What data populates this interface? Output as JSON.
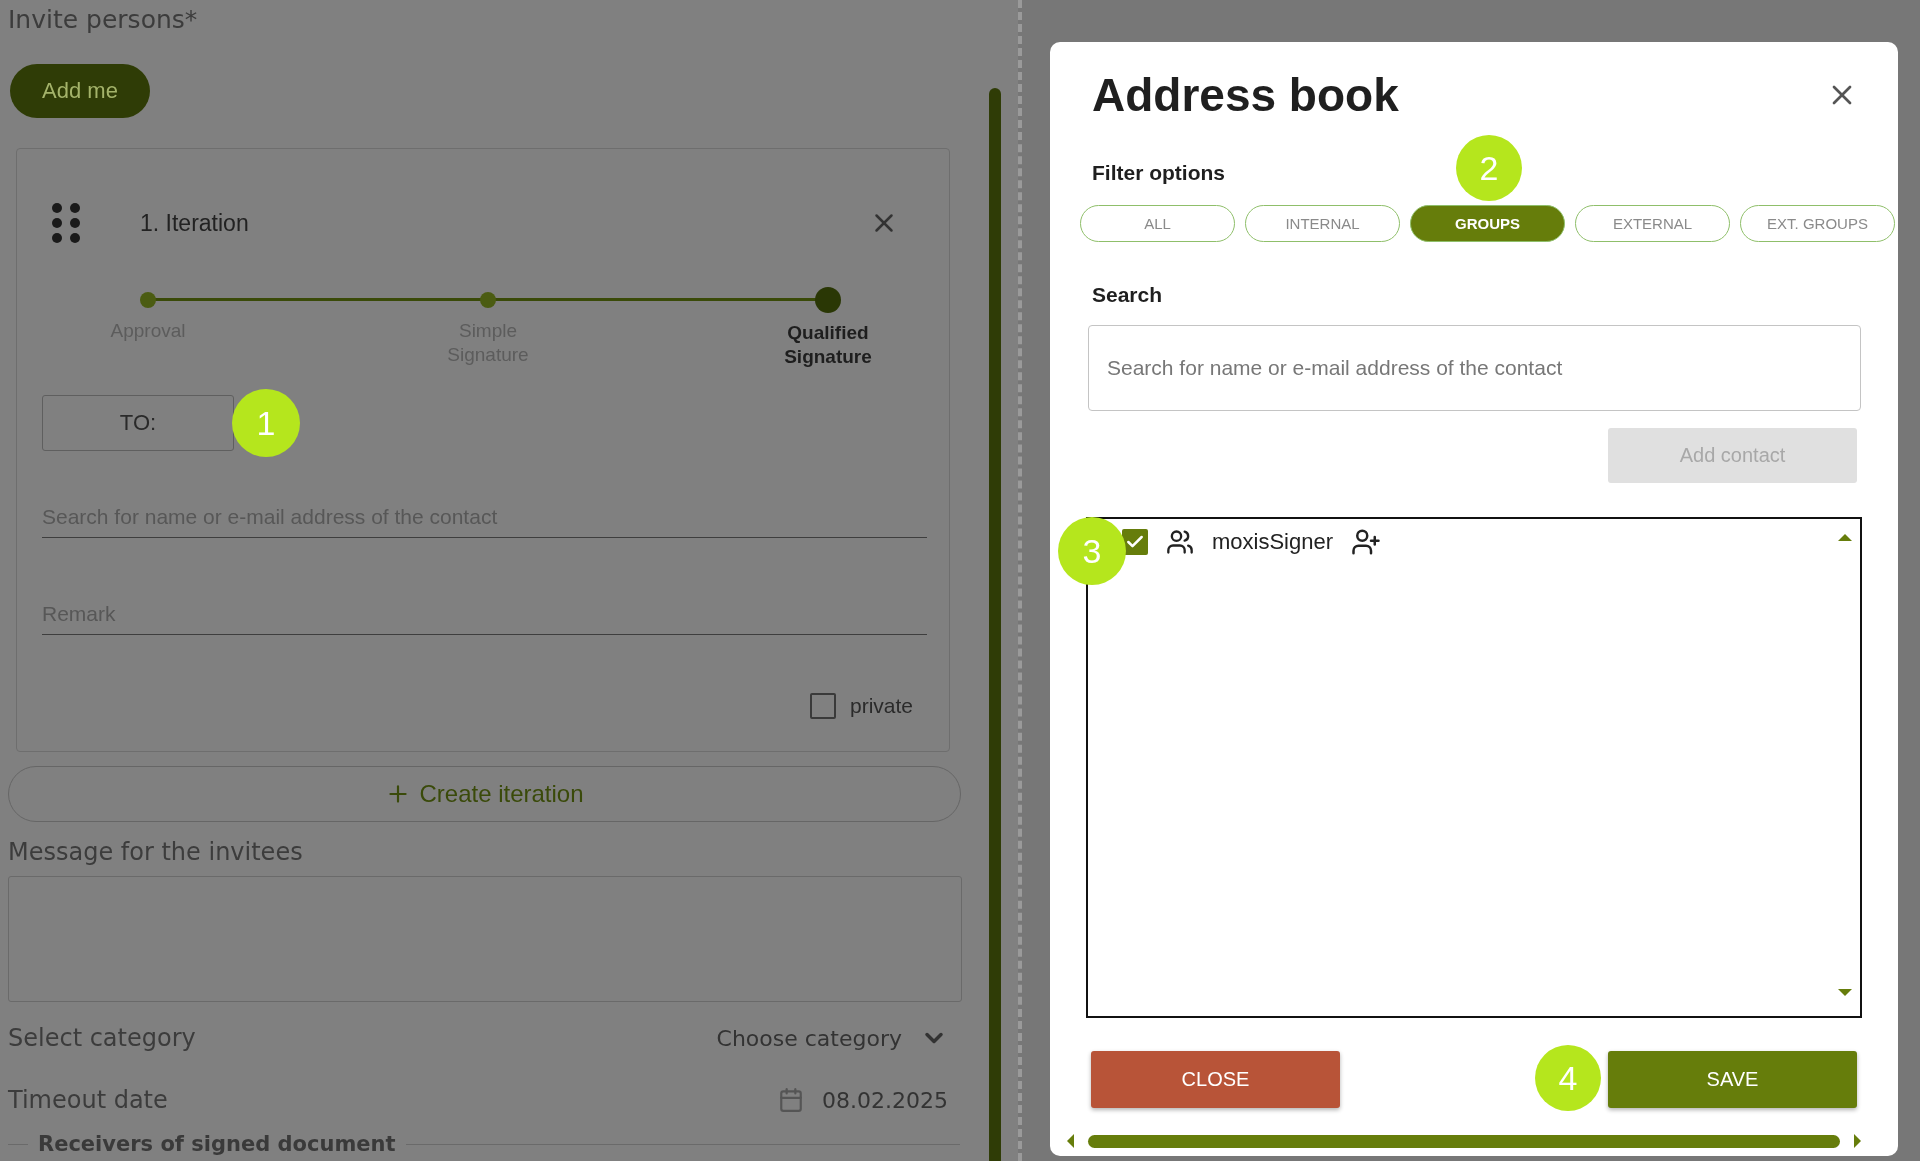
{
  "page": {
    "title": "Invite persons*",
    "add_me_button": "Add me",
    "iteration": {
      "title": "1. Iteration",
      "steps": [
        {
          "label": "Approval",
          "selected": false
        },
        {
          "label": "Simple Signature",
          "selected": false
        },
        {
          "label": "Qualified Signature",
          "selected": true
        }
      ],
      "to_button": "TO:",
      "to_marker": "1",
      "search_placeholder": "Search for name or e-mail address of the contact",
      "remark_placeholder": "Remark",
      "private": {
        "label": "private",
        "checked": false
      }
    },
    "create_iteration_button": "Create iteration",
    "message_label": "Message for the invitees",
    "category": {
      "label": "Select category",
      "value": "Choose category"
    },
    "timeout": {
      "label": "Timeout date",
      "value": "08.02.2025"
    },
    "receivers_legend": "Receivers of signed document"
  },
  "dialog": {
    "title": "Address book",
    "filter_label": "Filter options",
    "filter_marker": "2",
    "filters": [
      {
        "label": "ALL",
        "selected": false
      },
      {
        "label": "INTERNAL",
        "selected": false
      },
      {
        "label": "GROUPS",
        "selected": true
      },
      {
        "label": "EXTERNAL",
        "selected": false
      },
      {
        "label": "EXT. GROUPS",
        "selected": false
      }
    ],
    "search_label": "Search",
    "search_placeholder": "Search for name or e-mail address of the contact",
    "add_contact_button": {
      "label": "Add contact",
      "disabled": true
    },
    "list_marker": "3",
    "contacts": [
      {
        "name": "moxisSigner",
        "checked": true
      }
    ],
    "close_button": "CLOSE",
    "save_marker": "4",
    "save_button": "SAVE"
  }
}
